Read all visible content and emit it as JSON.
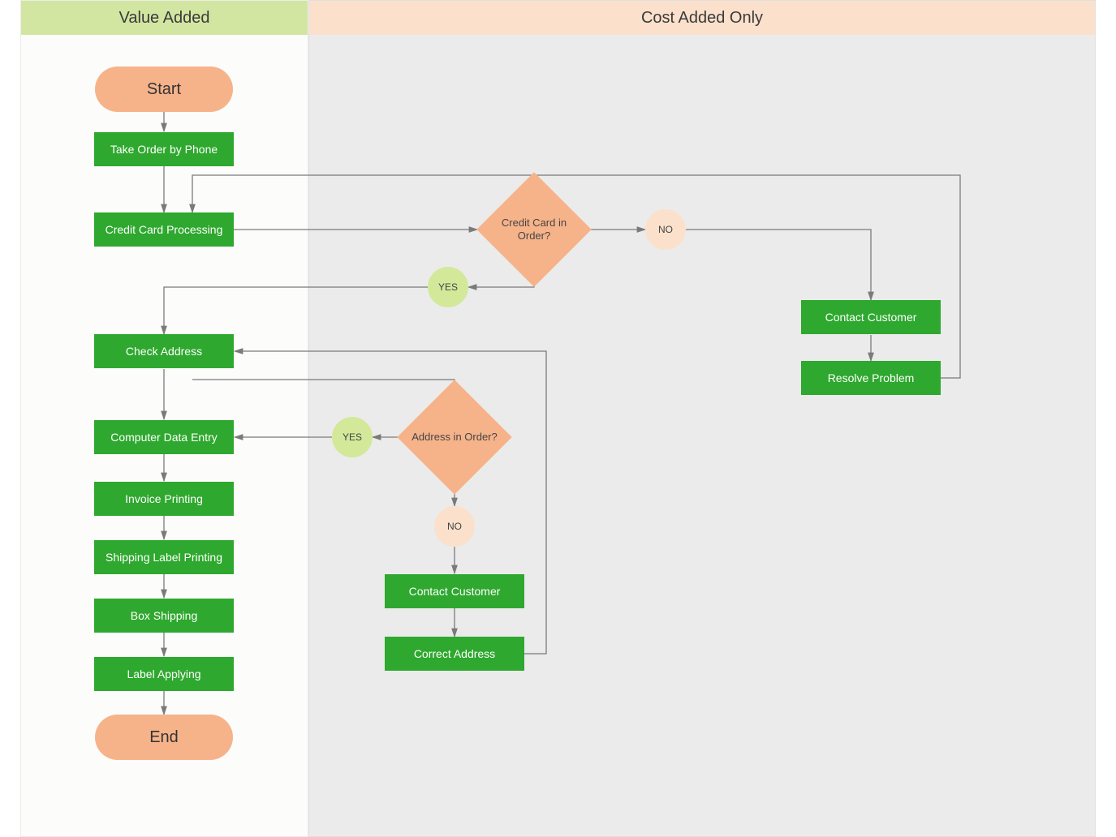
{
  "lanes": {
    "value_added": "Value Added",
    "cost_added": "Cost Added Only"
  },
  "terminators": {
    "start": "Start",
    "end": "End"
  },
  "processes": {
    "take_order": "Take Order by Phone",
    "cc_processing": "Credit Card Processing",
    "check_address": "Check Address",
    "data_entry": "Computer Data Entry",
    "invoice_printing": "Invoice Printing",
    "shipping_label": "Shipping Label Printing",
    "box_shipping": "Box Shipping",
    "label_applying": "Label Applying",
    "contact_customer_1": "Contact Customer",
    "resolve_problem": "Resolve Problem",
    "contact_customer_2": "Contact Customer",
    "correct_address": "Correct Address"
  },
  "decisions": {
    "cc_in_order": "Credit Card in Order?",
    "address_in_order": "Address in Order?"
  },
  "yn": {
    "yes1": "YES",
    "no1": "NO",
    "yes2": "YES",
    "no2": "NO"
  },
  "colors": {
    "process": "#2ea82e",
    "decision": "#f6b38a",
    "terminator": "#f6b38a",
    "yes": "#d4e89a",
    "no": "#fbe1cb",
    "lane_value": "#d3e6a1",
    "lane_cost": "#fbe1cb"
  }
}
